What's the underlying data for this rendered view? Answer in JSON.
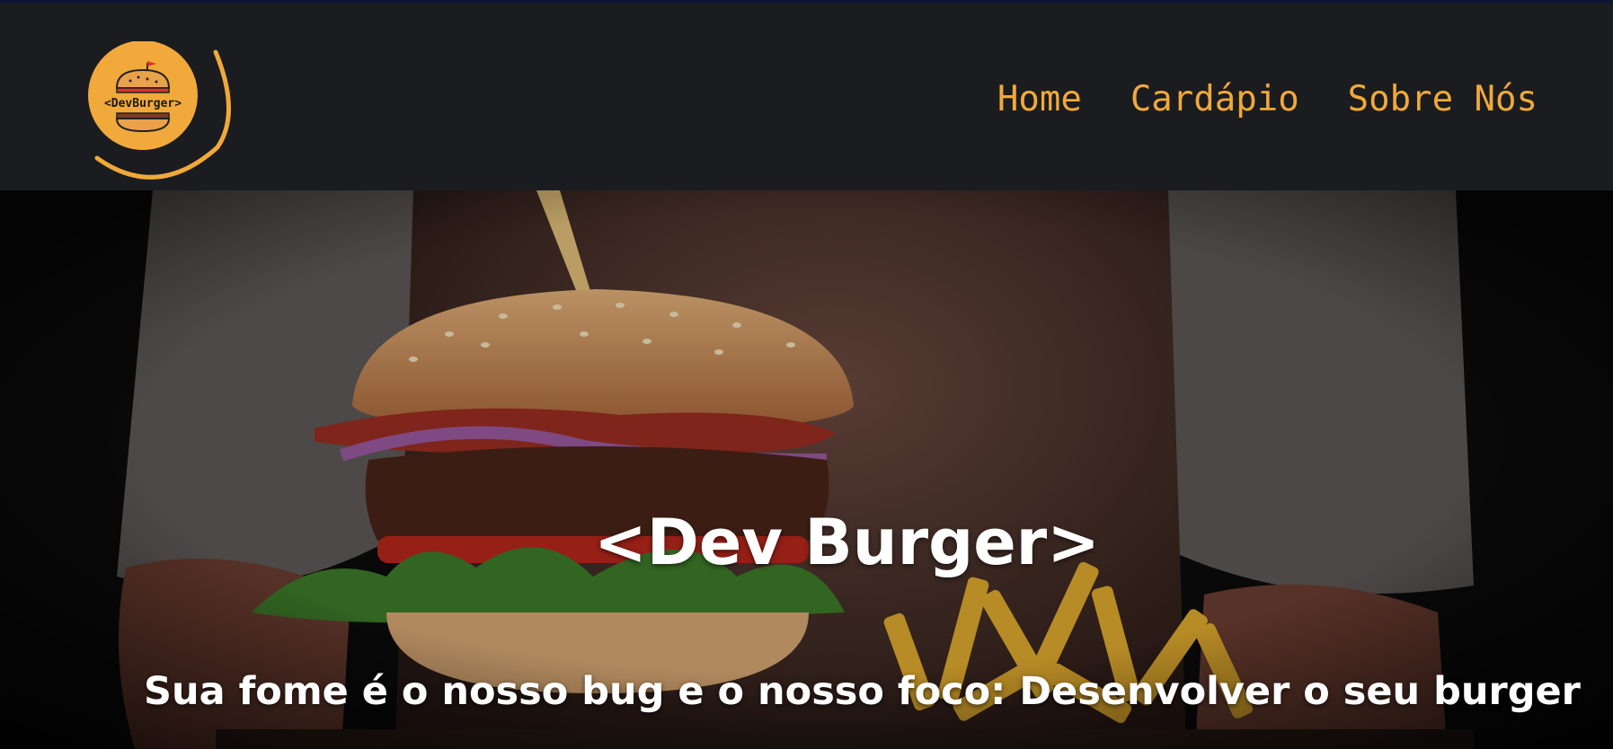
{
  "logo": {
    "text": "<DevBurger>"
  },
  "nav": {
    "items": [
      {
        "label": "Home"
      },
      {
        "label": "Cardápio"
      },
      {
        "label": "Sobre Nós"
      }
    ]
  },
  "hero": {
    "title": "<Dev Burger>",
    "subtitle": "Sua fome é o nosso bug e o nosso foco: Desenvolver o seu burger"
  },
  "colors": {
    "accent": "#f0a93a",
    "header_bg": "#1b1c20",
    "text": "#ffffff"
  },
  "icons": [
    "burger-logo-icon"
  ]
}
